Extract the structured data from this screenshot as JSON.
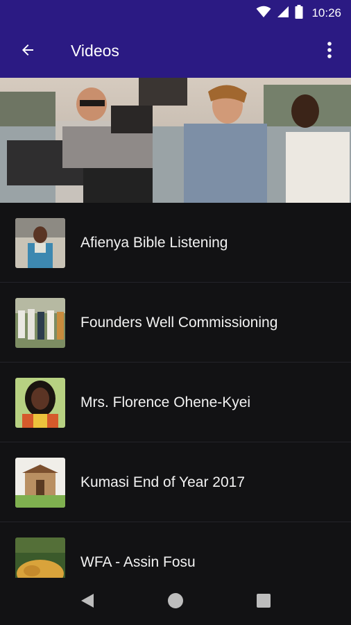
{
  "status": {
    "time": "10:26",
    "icons": [
      "wifi-icon",
      "cell-signal-icon",
      "battery-icon"
    ]
  },
  "app_bar": {
    "title": "Videos",
    "back_icon": "arrow-left-icon",
    "menu_icon": "more-vert-icon",
    "color": "#2b1a83"
  },
  "hero": {
    "description_icon": "tv-camera-crew-photo"
  },
  "videos": [
    {
      "title": "Afienya Bible Listening",
      "thumb": "woman-speaking-thumb"
    },
    {
      "title": "Founders Well Commissioning",
      "thumb": "crowd-outdoor-thumb"
    },
    {
      "title": "Mrs. Florence Ohene-Kyei",
      "thumb": "portrait-woman-thumb"
    },
    {
      "title": "Kumasi End of Year 2017",
      "thumb": "building-thumb"
    },
    {
      "title": "WFA - Assin Fosu",
      "thumb": "crops-harvest-thumb"
    }
  ],
  "nav": {
    "back": "nav-back-icon",
    "home": "nav-home-icon",
    "recents": "nav-recents-icon"
  }
}
